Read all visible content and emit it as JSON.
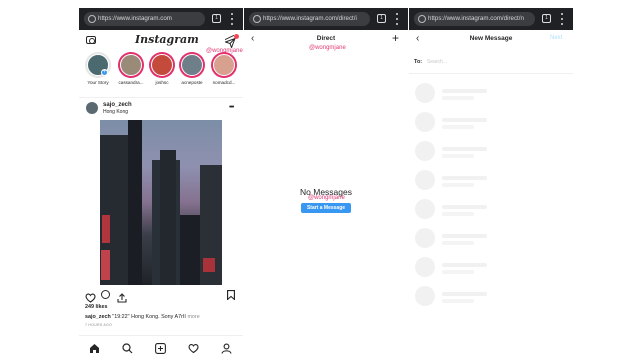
{
  "screens": [
    {
      "url": "https://www.instagram.com",
      "tab_count": "1"
    },
    {
      "url": "https://www.instagram.com/direct/i",
      "tab_count": "1"
    },
    {
      "url": "https://www.instagram.com/direct/n",
      "tab_count": "1"
    }
  ],
  "watermark": "@wongmjane",
  "feed": {
    "logo": "Instagram",
    "stories": [
      {
        "name": "Your Story",
        "color": "#4a6a6f"
      },
      {
        "name": "cassandra...",
        "color": "#9a8a78"
      },
      {
        "name": "joshsc",
        "color": "#c44b3c"
      },
      {
        "name": "acneposte",
        "color": "#6f7f8a"
      },
      {
        "name": "nomadcd...",
        "color": "#d8a08e"
      }
    ],
    "post": {
      "username": "sajo_zech",
      "location": "Hong Kong",
      "likes": "249 likes",
      "caption_user": "sajo_zech",
      "caption_text": " \"19:22\" Hong Kong. Sony A7rII",
      "caption_more": "more",
      "time_ago": "7 HOURS AGO"
    }
  },
  "direct": {
    "title": "Direct",
    "empty_text": "No Messages",
    "start_button": "Start a Message"
  },
  "new_message": {
    "title": "New Message",
    "next_label": "Next",
    "to_label": "To:",
    "search_placeholder": "Search...",
    "placeholder_rows": 8
  },
  "colors": {
    "accent": "#3897f0",
    "watermark": "#e03a76",
    "chrome": "#202124",
    "story_ring": "#e1306c"
  }
}
